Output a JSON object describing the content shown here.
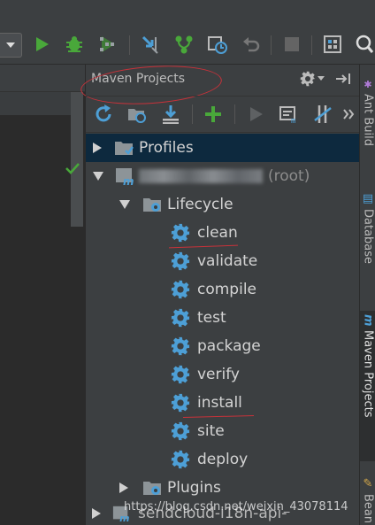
{
  "panel": {
    "title": "Maven Projects"
  },
  "tree": {
    "profiles": "Profiles",
    "project_suffix": "(root)",
    "lifecycle": "Lifecycle",
    "goals": [
      "clean",
      "validate",
      "compile",
      "test",
      "package",
      "verify",
      "install",
      "site",
      "deploy"
    ],
    "plugins": "Plugins",
    "partial_item": "sendcloud-i18n-api-"
  },
  "right_tabs": {
    "ant": "Ant Build",
    "database": "Database",
    "maven": "Maven Projects",
    "bean": "Bean"
  },
  "watermark": "https://blog.csdn.net/weixin_43078114",
  "colors": {
    "background": "#3c3f41",
    "selection": "#0d293e",
    "gear": "#4d9fd6",
    "annotation": "#c8323a",
    "run": "#49a83a"
  }
}
